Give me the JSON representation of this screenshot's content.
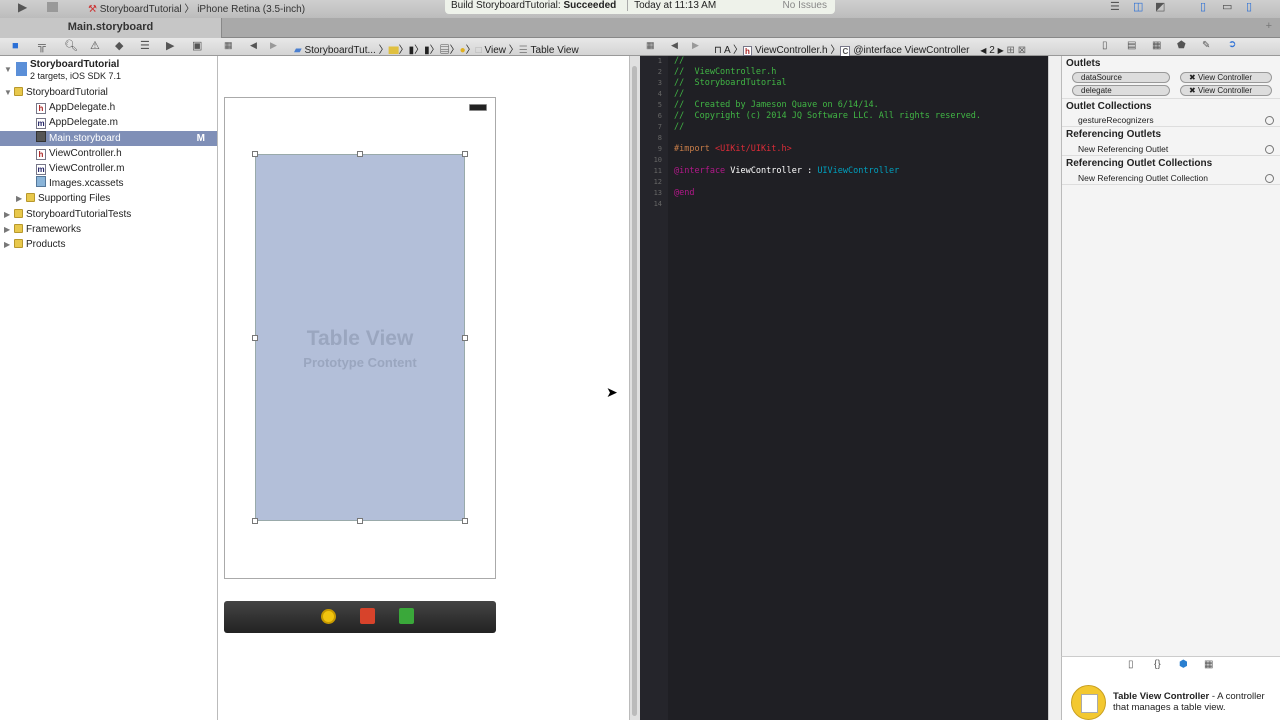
{
  "toolbar": {
    "scheme": "StoryboardTutorial",
    "device": "iPhone Retina (3.5-inch)",
    "status_prefix": "Build StoryboardTutorial: ",
    "status_result": "Succeeded",
    "time": "Today at 11:13 AM",
    "issues": "No Issues"
  },
  "tab": {
    "label": "Main.storyboard"
  },
  "jumpbar_left": {
    "items": [
      "StoryboardTut...",
      "View",
      "Table View"
    ]
  },
  "jumpbar_right": {
    "mode": "A",
    "file": "ViewController.h",
    "symbol": "@interface ViewController",
    "counter": "2"
  },
  "navigator": {
    "project": {
      "name": "StoryboardTutorial",
      "subtitle": "2 targets, iOS SDK 7.1"
    },
    "items": [
      {
        "label": "StoryboardTutorial",
        "type": "folder",
        "expanded": true,
        "indent": 1
      },
      {
        "label": "AppDelegate.h",
        "type": "h",
        "indent": 2
      },
      {
        "label": "AppDelegate.m",
        "type": "m",
        "indent": 2
      },
      {
        "label": "Main.storyboard",
        "type": "storyboard",
        "indent": 2,
        "selected": true,
        "badge": "M"
      },
      {
        "label": "ViewController.h",
        "type": "h",
        "indent": 2
      },
      {
        "label": "ViewController.m",
        "type": "m",
        "indent": 2
      },
      {
        "label": "Images.xcassets",
        "type": "assets",
        "indent": 2
      },
      {
        "label": "Supporting Files",
        "type": "folder",
        "indent": 2
      },
      {
        "label": "StoryboardTutorialTests",
        "type": "folder",
        "indent": 1
      },
      {
        "label": "Frameworks",
        "type": "folder",
        "indent": 1
      },
      {
        "label": "Products",
        "type": "folder",
        "indent": 1
      }
    ]
  },
  "canvas": {
    "table_title": "Table View",
    "table_subtitle": "Prototype Content",
    "table_color": "#b3bfd9"
  },
  "editor": {
    "lines": [
      [
        [
          "//",
          "#41b645"
        ]
      ],
      [
        [
          "//  ViewController.h",
          "#41b645"
        ]
      ],
      [
        [
          "//  StoryboardTutorial",
          "#41b645"
        ]
      ],
      [
        [
          "//",
          "#41b645"
        ]
      ],
      [
        [
          "//  Created by Jameson Quave on 6/14/14.",
          "#41b645"
        ]
      ],
      [
        [
          "//  Copyright (c) 2014 JQ Software LLC. All rights reserved.",
          "#41b645"
        ]
      ],
      [
        [
          "//",
          "#41b645"
        ]
      ],
      [],
      [
        [
          "#import ",
          "#c67c48"
        ],
        [
          "<UIKit/UIKit.h>",
          "#db2c38"
        ]
      ],
      [],
      [
        [
          "@interface ",
          "#b21889"
        ],
        [
          "ViewController",
          "#ffffff"
        ],
        [
          " : ",
          "#ffffff"
        ],
        [
          "UIViewController",
          "#00a0be"
        ]
      ],
      [],
      [
        [
          "@end",
          "#b21889"
        ]
      ],
      []
    ]
  },
  "inspector": {
    "outlets_title": "Outlets",
    "outlets": [
      {
        "name": "dataSource",
        "target": "View Controller"
      },
      {
        "name": "delegate",
        "target": "View Controller"
      }
    ],
    "outlet_collections_title": "Outlet Collections",
    "outlet_collections": [
      "gestureRecognizers"
    ],
    "referencing_outlets_title": "Referencing Outlets",
    "referencing_outlets": [
      "New Referencing Outlet"
    ],
    "referencing_collections_title": "Referencing Outlet Collections",
    "referencing_collections": [
      "New Referencing Outlet Collection"
    ]
  },
  "library": {
    "title": "Table View Controller",
    "desc": " - A controller that manages a table view."
  }
}
